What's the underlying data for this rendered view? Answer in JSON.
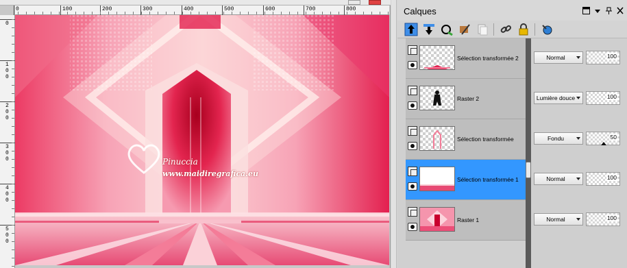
{
  "canvas": {
    "horizontal_ruler_labels": [
      "0",
      "100",
      "200",
      "300",
      "400",
      "500",
      "600",
      "700",
      "800"
    ],
    "vertical_ruler_labels": [
      "0",
      "100",
      "200",
      "300",
      "400",
      "500"
    ],
    "watermark": {
      "name": "Pinuccia",
      "url": "www.maidiregrafica.eu"
    }
  },
  "panel": {
    "title": "Calques",
    "header_controls": [
      "square-icon",
      "dropdown-icon",
      "pin-icon",
      "close-icon"
    ],
    "toolbar_icons": [
      "new-raster-layer-icon",
      "new-mask-layer-icon",
      "new-adjustment-layer-icon",
      "brush-icon",
      "duplicate-icon",
      "link-icon",
      "lock-icon",
      "eye-visibility-icon"
    ],
    "layers": [
      {
        "name": "Sélection transformée 2",
        "blend_mode": "Normal",
        "opacity": 100,
        "selected": false,
        "thumbnail": "pink-base-strip"
      },
      {
        "name": "Raster 2",
        "blend_mode": "Lumière douce",
        "opacity": 100,
        "selected": false,
        "thumbnail": "dark-figure"
      },
      {
        "name": "Sélection transformée",
        "blend_mode": "Fondu",
        "opacity": 50,
        "selected": false,
        "thumbnail": "pink-arch-outline"
      },
      {
        "name": "Sélection transformée 1",
        "blend_mode": "Normal",
        "opacity": 100,
        "selected": true,
        "thumbnail": "pink-floor-strip"
      },
      {
        "name": "Raster 1",
        "blend_mode": "Normal",
        "opacity": 100,
        "selected": false,
        "thumbnail": "pink-background"
      }
    ]
  },
  "colors": {
    "selection": "#3397ff",
    "accent_pink": "#e8336a",
    "light_pink": "#f9b9c6"
  }
}
